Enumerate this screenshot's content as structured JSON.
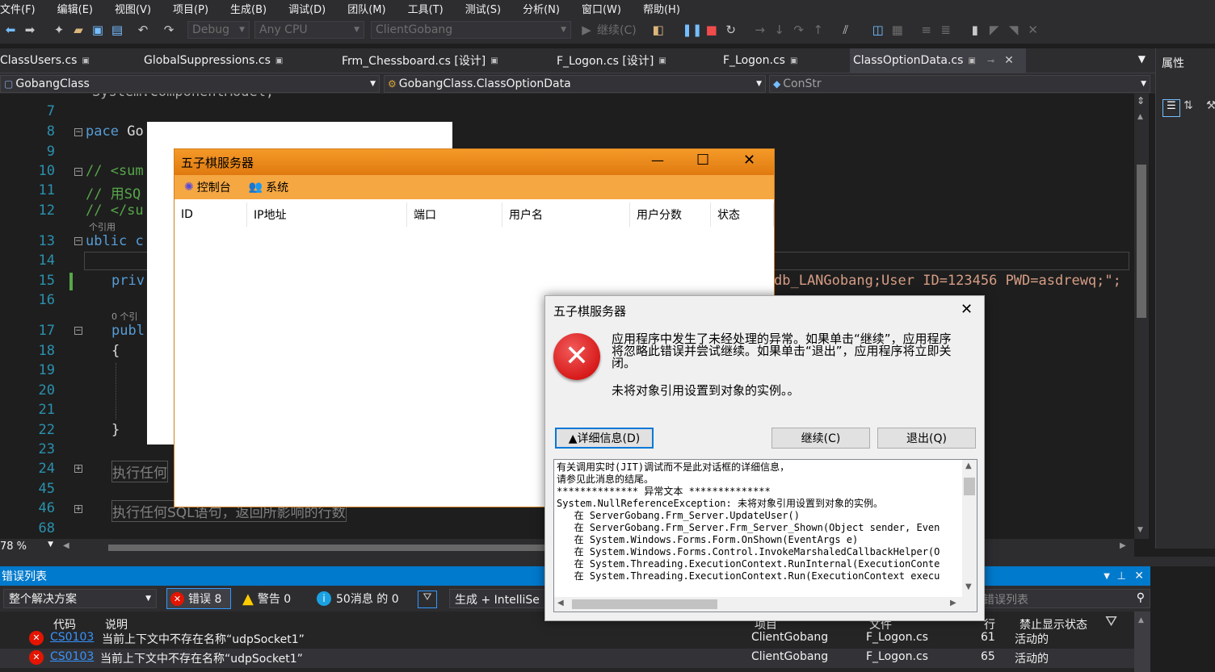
{
  "menu": [
    "文件(F)",
    "编辑(E)",
    "视图(V)",
    "项目(P)",
    "生成(B)",
    "调试(D)",
    "团队(M)",
    "工具(T)",
    "测试(S)",
    "分析(N)",
    "窗口(W)",
    "帮助(H)"
  ],
  "toolbar": {
    "config": "Debug",
    "platform": "Any CPU",
    "startup": "ClientGobang",
    "continue": "继续(C)"
  },
  "tabs": [
    "ClassUsers.cs",
    "GlobalSuppressions.cs",
    "Frm_Chessboard.cs [设计]",
    "F_Logon.cs [设计]",
    "F_Logon.cs",
    "ClassOptionData.cs"
  ],
  "nav": {
    "project": "GobangClass",
    "class": "GobangClass.ClassOptionData",
    "member": "ConStr"
  },
  "properties_tab": "属性",
  "editor": {
    "lines": [
      "7",
      "8",
      "9",
      "10",
      "11",
      "12",
      "13",
      "14",
      "15",
      "16",
      "17",
      "18",
      "19",
      "20",
      "21",
      "22",
      "23",
      "24",
      "45",
      "46",
      "68"
    ],
    "l6": "System.ComponentModel;",
    "l8a": "pace",
    "l8b": "Go",
    "l10": "// <sum",
    "l11": "// 用SQ",
    "l12": "// </su",
    "ref1": "个引用",
    "l13a": "ublic",
    "l13b": "c",
    "l15a": "priv",
    "l15b": "db_LANGobang;User ID=123456 PWD=asdrewq;\";",
    "ref0": "0 个引",
    "l17": "publ",
    "l18": "{",
    "l22": "}",
    "l24": "执行任何",
    "l46": "执行任何SQL语句，返回所影响的行数",
    "zoom": "78 %"
  },
  "errorlist": {
    "title": "错误列表",
    "scope": "整个解决方案",
    "errors": "错误 8",
    "warnings": "警告 0",
    "messages": "50消息 的 0",
    "build": "生成 + IntelliSe",
    "search": "错误列表",
    "cols": {
      "code": "代码",
      "desc": "说明",
      "project": "项目",
      "file": "文件",
      "line": "行",
      "state": "禁止显示状态"
    },
    "rows": [
      {
        "code": "CS0103",
        "desc": "当前上下文中不存在名称“udpSocket1”",
        "project": "ClientGobang",
        "file": "F_Logon.cs",
        "line": "61",
        "state": "活动的"
      },
      {
        "code": "CS0103",
        "desc": "当前上下文中不存在名称“udpSocket1”",
        "project": "ClientGobang",
        "file": "F_Logon.cs",
        "line": "65",
        "state": "活动的"
      }
    ]
  },
  "server": {
    "title": "五子棋服务器",
    "menu": [
      "控制台",
      "系统"
    ],
    "columns": [
      "ID",
      "IP地址",
      "端口",
      "用户名",
      "用户分数",
      "状态"
    ]
  },
  "error": {
    "title": "五子棋服务器",
    "message1": "应用程序中发生了未经处理的异常。如果单击“继续”，应用程序将忽略此错误并尝试继续。如果单击“退出”，应用程序将立即关闭。",
    "message2": "未将对象引用设置到对象的实例。。",
    "details": "▲详细信息(D)",
    "continue": "继续(C)",
    "quit": "退出(Q)",
    "detail_lines": [
      "有关调用实时(JIT)调试而不是此对话框的详细信息，",
      "请参见此消息的结尾。",
      "",
      "************** 异常文本 **************",
      "System.NullReferenceException: 未将对象引用设置到对象的实例。",
      "   在 ServerGobang.Frm_Server.UpdateUser()",
      "   在 ServerGobang.Frm_Server.Frm_Server_Shown(Object sender, Even",
      "   在 System.Windows.Forms.Form.OnShown(EventArgs e)",
      "   在 System.Windows.Forms.Control.InvokeMarshaledCallbackHelper(O",
      "   在 System.Threading.ExecutionContext.RunInternal(ExecutionConte",
      "   在 System.Threading.ExecutionContext.Run(ExecutionContext execu"
    ]
  }
}
